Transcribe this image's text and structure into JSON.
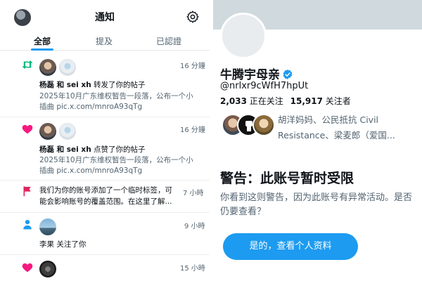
{
  "notifications_panel": {
    "title": "通知",
    "tabs": [
      {
        "label": "全部",
        "active": true
      },
      {
        "label": "提及",
        "active": false
      },
      {
        "label": "已認證",
        "active": false
      }
    ],
    "items": [
      {
        "type": "repost",
        "icon": "retweet-icon",
        "time": "16 分鐘",
        "users": "杨磊 和 sei xh",
        "action": "转发了你的帖子",
        "text_line1": "2025年10月广东维权暂告一段落，公布一个小",
        "text_line2": "插曲 pic.x.com/mnroA93qTg"
      },
      {
        "type": "like",
        "icon": "heart-icon",
        "time": "16 分鐘",
        "users": "杨磊 和 sei xh",
        "action": "点赞了你的帖子",
        "text_line1": "2025年10月广东维权暂告一段落，公布一个小",
        "text_line2": "插曲 pic.x.com/mnroA93qTg"
      },
      {
        "type": "label",
        "icon": "flag-icon",
        "time": "7 小時",
        "text_line1": "我们为你的账号添加了一个临时标签，可",
        "text_line2": "能会影响账号的覆盖范围。在这里了解..."
      },
      {
        "type": "follow",
        "icon": "person-icon",
        "time": "9 小時",
        "text": "李果 关注了你"
      },
      {
        "type": "like",
        "icon": "heart-icon",
        "time": "15 小時"
      }
    ]
  },
  "profile_panel": {
    "display_name": "牛腾宇母亲",
    "handle": "@nrlxr9cWfH7hpUt",
    "following_count": "2,033",
    "following_label": "正在关注",
    "followers_count": "15,917",
    "followers_label": "关注者",
    "followed_by_line1": "胡洋妈妈、公民抵抗 Civil",
    "followed_by_line2": "Resistance、梁麦郎（爱国...",
    "warning_title": "警告：此账号暂时受限",
    "warning_body": "你看到这则警告，因为此账号有异常活动。是否仍要查看？",
    "view_button": "是的，查看个人资料"
  },
  "colors": {
    "accent": "#1d9bf0",
    "repost": "#00ba7c",
    "like": "#f91880",
    "flag": "#e0245e",
    "text": "#0f1419",
    "muted": "#536471"
  }
}
